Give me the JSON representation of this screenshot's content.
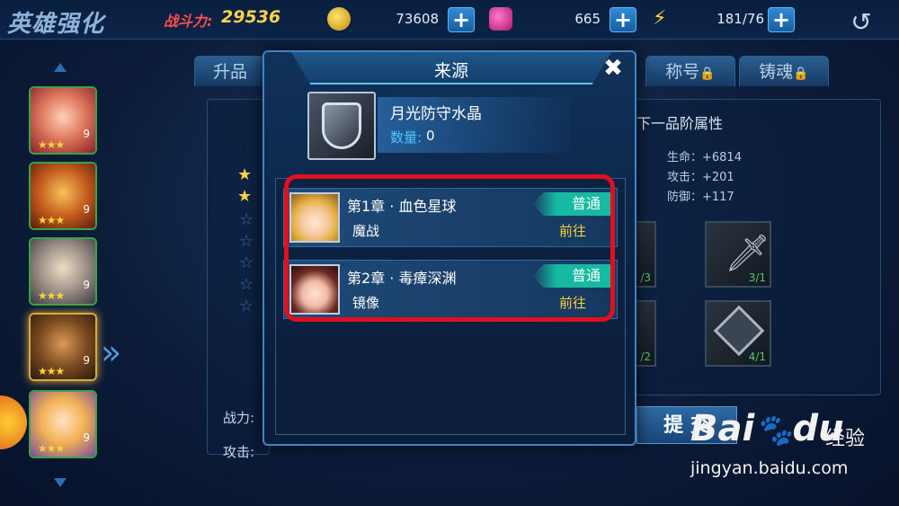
{
  "header": {
    "title": "英雄强化",
    "power_label": "战斗力:",
    "power_value": "29536",
    "gold": "73608",
    "gems": "665",
    "energy": "181/76",
    "back_icon": "back-arrow-icon"
  },
  "tabs": {
    "upgrade": "升品",
    "title": "称号",
    "soul": "铸魂"
  },
  "right_panel": {
    "next_grade_label": "下一品阶属性",
    "hp": "生命：+6814",
    "atk": "攻击：+201",
    "def": "防御：+117",
    "equip_counts": [
      "/3",
      "3/1",
      "/2",
      "4/1"
    ]
  },
  "bottom": {
    "power_label": "战力:",
    "atk_label": "攻击:",
    "submit": "提 交"
  },
  "modal": {
    "title": "来源",
    "item_name": "月光防守水晶",
    "qty_label": "数量:",
    "qty_value": "0",
    "sources": [
      {
        "chapter": "第1章 · 血色星球",
        "stage": "魔战",
        "difficulty": "普通",
        "goto": "前往"
      },
      {
        "chapter": "第2章 · 毒瘴深渊",
        "stage": "镜像",
        "difficulty": "普通",
        "goto": "前往"
      }
    ]
  },
  "heroes": [
    {
      "level": "9"
    },
    {
      "level": "9"
    },
    {
      "level": "9"
    },
    {
      "level": "9"
    },
    {
      "level": "9"
    }
  ],
  "watermark": {
    "brand": "Bai",
    "brand_tail": "du",
    "sub": "经验",
    "url": "jingyan.baidu.com"
  },
  "colors": {
    "accent": "#3b86c6",
    "difficulty": "#16b9a1",
    "goto": "#ffd23d",
    "highlight": "#e0101e"
  }
}
